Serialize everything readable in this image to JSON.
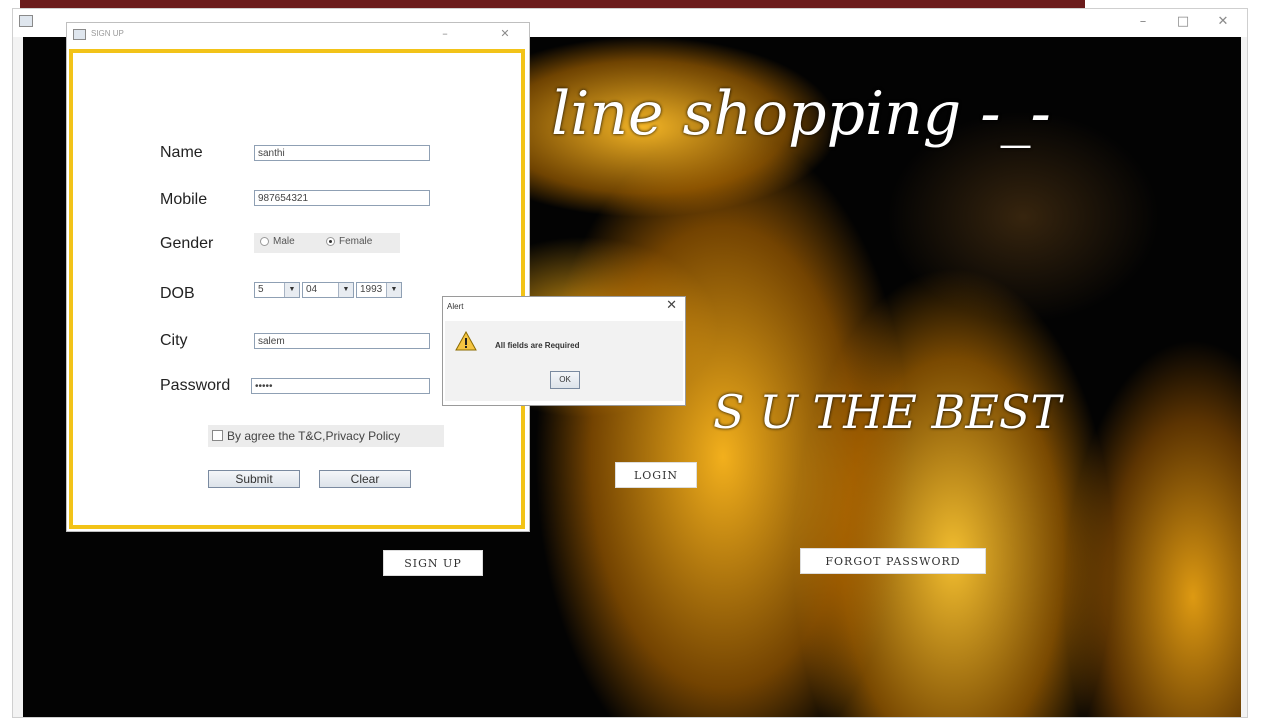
{
  "main_window": {
    "controls": {
      "minimize": "–",
      "maximize": "□",
      "close": "✕"
    },
    "headline": "line shopping -_-",
    "tagline": "S U THE BEST",
    "buttons": {
      "login": "LOGIN",
      "signup": "SIGN UP",
      "forgot_password": "FORGOT PASSWORD"
    }
  },
  "signup_window": {
    "title": "SIGN UP",
    "controls": {
      "minimize": "–",
      "close": "✕"
    },
    "fields": {
      "name": {
        "label": "Name",
        "value": "santhi"
      },
      "mobile": {
        "label": "Mobile",
        "value": "987654321"
      },
      "gender": {
        "label": "Gender",
        "options": [
          "Male",
          "Female"
        ],
        "selected": "Female"
      },
      "dob": {
        "label": "DOB",
        "day": "5",
        "month": "04",
        "year": "1993"
      },
      "city": {
        "label": "City",
        "value": "salem"
      },
      "password": {
        "label": "Password",
        "value": "•••••"
      }
    },
    "terms_label": "By agree the T&C,Privacy Policy",
    "submit_label": "Submit",
    "clear_label": "Clear"
  },
  "alert": {
    "title": "Alert",
    "close": "✕",
    "message": "All fields are Required",
    "ok_label": "OK",
    "icon": "warning-icon"
  },
  "colors": {
    "top_bar": "#6b1c1c",
    "form_border": "#f2c318",
    "background": "#030303",
    "petal": "#f5b21e"
  }
}
